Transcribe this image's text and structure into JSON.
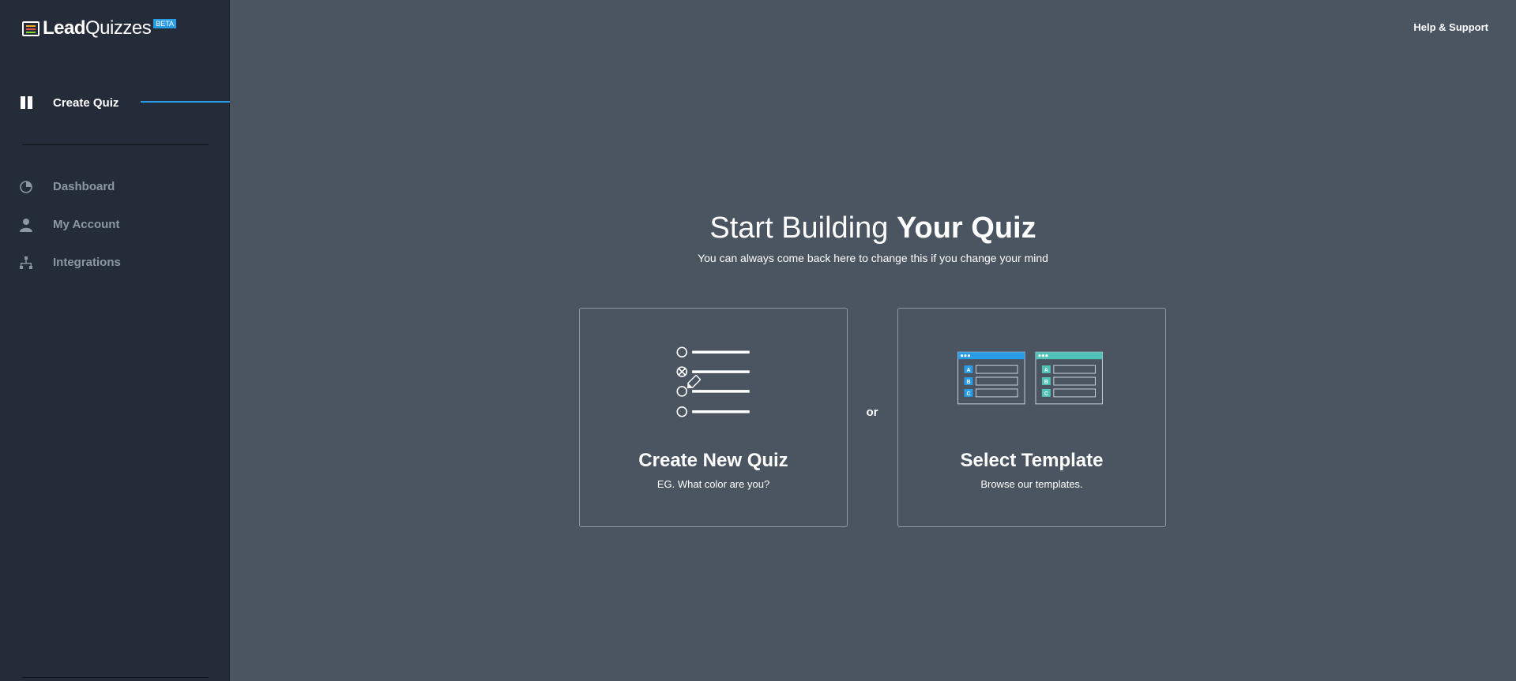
{
  "brand": {
    "name_bold": "Lead",
    "name_light": "Quizzes",
    "badge": "BETA"
  },
  "sidebar": {
    "active": {
      "label": "Create Quiz"
    },
    "items": [
      {
        "label": "Dashboard",
        "icon": "pie-chart-icon"
      },
      {
        "label": "My Account",
        "icon": "user-icon"
      },
      {
        "label": "Integrations",
        "icon": "sitemap-icon"
      }
    ]
  },
  "header": {
    "help_label": "Help & Support"
  },
  "main": {
    "title_regular": "Start Building ",
    "title_bold": "Your Quiz",
    "subtitle": "You can always come back here to change this if you change your mind",
    "or_label": "or",
    "cards": [
      {
        "title": "Create New Quiz",
        "desc": "EG. What color are you?",
        "icon": "quiz-list-icon"
      },
      {
        "title": "Select Template",
        "desc": "Browse our templates.",
        "icon": "templates-icon"
      }
    ],
    "template_letters": [
      "A",
      "B",
      "C"
    ]
  },
  "colors": {
    "sidebar_bg": "#232c38",
    "main_bg": "#4a5561",
    "accent_blue": "#2a9be6",
    "accent_teal": "#4fc3b7",
    "muted_text": "#8d97a2"
  }
}
